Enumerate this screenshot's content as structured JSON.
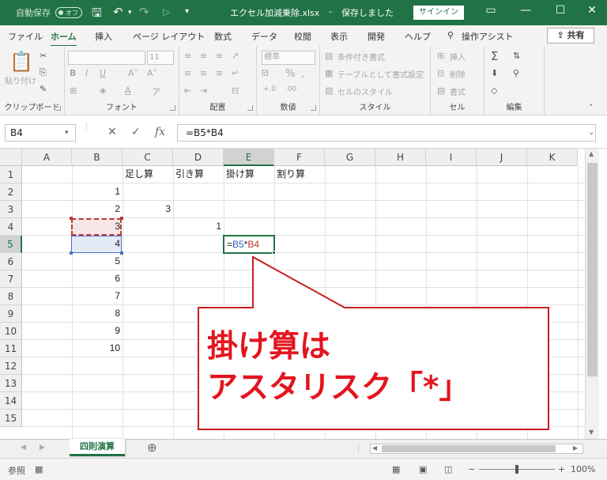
{
  "titlebar": {
    "autosave_label": "自動保存",
    "autosave_state": "オフ",
    "filename": "エクセル加減乗除.xlsx",
    "separator": "-",
    "save_status": "保存しました",
    "signin": "サインイン",
    "bg_color": "#217346"
  },
  "tabs": [
    "ファイル",
    "ホーム",
    "挿入",
    "ページ レイアウト",
    "数式",
    "データ",
    "校閲",
    "表示",
    "開発",
    "ヘルプ"
  ],
  "active_tab": "ホーム",
  "tell_me": "操作アシスト",
  "share_label": "共有",
  "ribbon": {
    "clipboard": {
      "paste": "貼り付け",
      "label": "クリップボード"
    },
    "font": {
      "font_size": "11",
      "label": "フォント"
    },
    "alignment": {
      "label": "配置"
    },
    "number": {
      "format": "標準",
      "label": "数値"
    },
    "styles": {
      "conditional": "条件付き書式",
      "table": "テーブルとして書式設定",
      "cell_style": "セルのスタイル",
      "label": "スタイル"
    },
    "cells": {
      "insert": "挿入",
      "delete": "削除",
      "format": "書式",
      "label": "セル"
    },
    "editing": {
      "label": "編集"
    }
  },
  "formula_bar": {
    "name_box": "B4",
    "formula": "=B5*B4"
  },
  "grid": {
    "columns": [
      "A",
      "B",
      "C",
      "D",
      "E",
      "F",
      "G",
      "H",
      "I",
      "J",
      "K"
    ],
    "rows": [
      "1",
      "2",
      "3",
      "4",
      "5",
      "6",
      "7",
      "8",
      "9",
      "10",
      "11",
      "12",
      "13",
      "14",
      "15"
    ],
    "headers_row1": {
      "C": "足し算",
      "D": "引き算",
      "E": "掛け算",
      "F": "割り算"
    },
    "col_b": [
      "1",
      "2",
      "3",
      "4",
      "5",
      "6",
      "7",
      "8",
      "9",
      "10"
    ],
    "c3": "3",
    "d4": "1",
    "e5_prefix": "=",
    "e5_ref1": "B5",
    "e5_op": "*",
    "e5_ref2": "B4",
    "ref1_color": "#2f5fbf",
    "ref2_color": "#c0392b"
  },
  "callout": {
    "line1": "掛け算は",
    "line2": "アスタリスク「*」",
    "text_color": "#e3151f",
    "border_color": "#c81e1e"
  },
  "sheet_tab": "四則演算",
  "status": {
    "mode": "参照",
    "zoom": "100%"
  }
}
